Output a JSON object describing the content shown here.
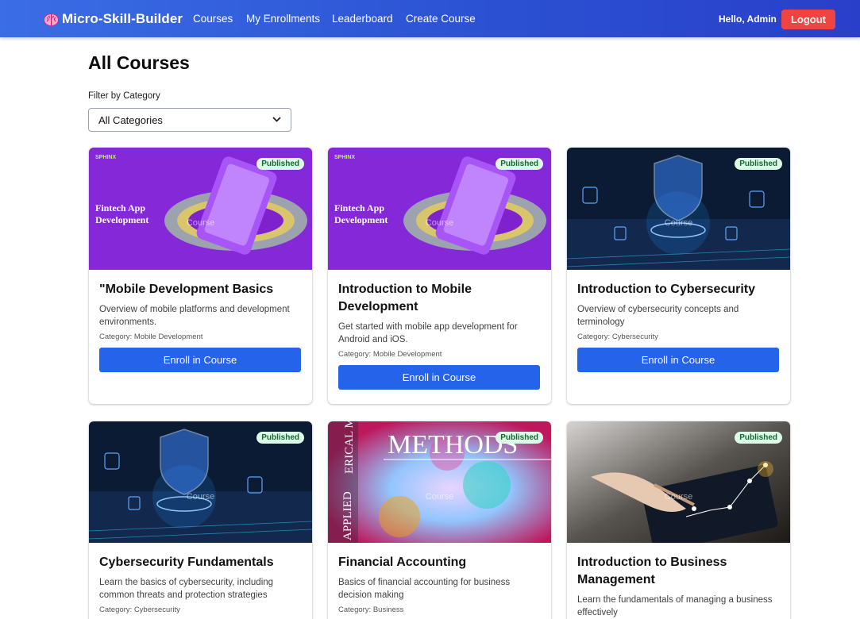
{
  "nav": {
    "brand": "Micro-Skill-Builder",
    "links": [
      "Courses",
      "My Enrollments",
      "Leaderboard",
      "Create Course"
    ],
    "greeting": "Hello, Admin",
    "logout": "Logout",
    "brand_icon": "brain-icon",
    "colors": {
      "nav_start": "#3b6de6",
      "nav_end": "#2a3fc9",
      "logout": "#ef4444"
    }
  },
  "page": {
    "title": "All Courses",
    "filter_label": "Filter by Category",
    "filter_value": "All Categories"
  },
  "courses": [
    {
      "title": "\"Mobile Development Basics",
      "description": "Overview of mobile platforms and development environments.",
      "category": "Category: Mobile Development",
      "status": "Published",
      "thumb_caption": "Course",
      "thumb_text": [
        "Fintech App",
        "Development"
      ],
      "thumb_logo": "SPHINX",
      "enroll": "Enroll in Course"
    },
    {
      "title": "Introduction to Mobile Development",
      "description": "Get started with mobile app development for Android and iOS.",
      "category": "Category: Mobile Development",
      "status": "Published",
      "thumb_caption": "Course",
      "thumb_text": [
        "Fintech App",
        "Development"
      ],
      "thumb_logo": "SPHINX",
      "enroll": "Enroll in Course"
    },
    {
      "title": "Introduction to Cybersecurity",
      "description": "Overview of cybersecurity concepts and terminology",
      "category": "Category: Cybersecurity",
      "status": "Published",
      "thumb_caption": "Course",
      "enroll": "Enroll in Course"
    },
    {
      "title": "Cybersecurity Fundamentals",
      "description": "Learn the basics of cybersecurity, including common threats and protection strategies",
      "category": "Category: Cybersecurity",
      "status": "Published",
      "thumb_caption": "Course"
    },
    {
      "title": "Financial Accounting",
      "description": "Basics of financial accounting for business decision making",
      "category": "Category: Business",
      "status": "Published",
      "thumb_caption": "Course",
      "thumb_text": [
        "METHODS",
        "APPLIED",
        "ERICAL METHODS"
      ]
    },
    {
      "title": "Introduction to Business Management",
      "description": "Learn the fundamentals of managing a business effectively",
      "status": "Published",
      "thumb_caption": "Course"
    }
  ]
}
